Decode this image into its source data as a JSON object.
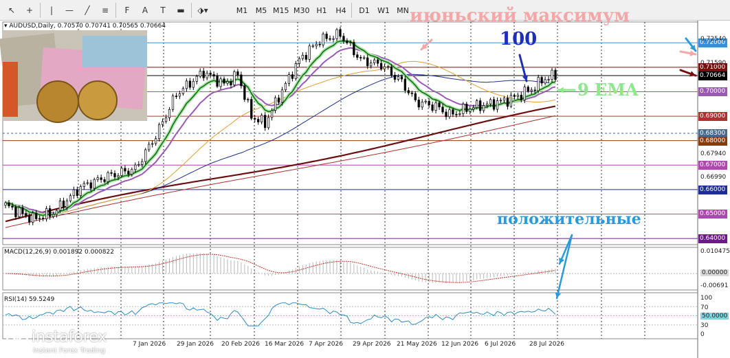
{
  "toolbar": {
    "tools": [
      {
        "name": "cursor-icon",
        "glyph": "↖"
      },
      {
        "name": "crosshair-icon",
        "glyph": "+"
      },
      {
        "name": "vertical-line-icon",
        "glyph": "|"
      },
      {
        "name": "horizontal-line-icon",
        "glyph": "—"
      },
      {
        "name": "trendline-icon",
        "glyph": "╱"
      },
      {
        "name": "channel-icon",
        "glyph": "≡"
      },
      {
        "name": "fibonacci-icon",
        "glyph": "F"
      },
      {
        "name": "text-icon",
        "glyph": "A"
      },
      {
        "name": "label-icon",
        "glyph": "T"
      },
      {
        "name": "rectangle-icon",
        "glyph": "▬"
      },
      {
        "name": "shapes-icon",
        "glyph": "⬗▾"
      }
    ],
    "timeframes": [
      "M1",
      "M5",
      "M15",
      "M30",
      "H1",
      "H4",
      "D1",
      "W1",
      "MN"
    ]
  },
  "header": {
    "symbol": "AUDUSD,Daily",
    "ohlc": "0.70570 0.70741 0.70565 0.70664"
  },
  "colors": {
    "candle_up": "#ffffff",
    "candle_down": "#000000",
    "ema9": "#1a6b1a",
    "ema9_glow": "#a6e6a6",
    "ma_purple": "#9b59b6",
    "ma_blue": "#1e2f8f",
    "ma_orange": "#e0a030",
    "ma_maroon": "#6b0f0f",
    "ma_red": "#b03030",
    "macd_hist": "#b8b8b8",
    "macd_signal": "#c0392b",
    "rsi": "#2e8bc0"
  },
  "price_axis": {
    "ticks": [
      {
        "value": "0.72540"
      },
      {
        "value": "0.71590"
      },
      {
        "value": "0.70000",
        "tag": true,
        "color": "#9b59b6"
      },
      {
        "value": "0.67940"
      },
      {
        "value": "0.66990"
      }
    ],
    "levels": [
      {
        "value": 0.72,
        "label": "0.72000",
        "color": "#3a8fd6"
      },
      {
        "value": 0.71,
        "label": "0.71000",
        "color": "#7a0e0e"
      },
      {
        "value": 0.7066,
        "label": "0.70664",
        "color": "#000000"
      },
      {
        "value": 0.7,
        "label": "0.70000",
        "color": "#9b59b6"
      },
      {
        "value": 0.69,
        "label": "0.69000",
        "color": "#b03030"
      },
      {
        "value": 0.683,
        "label": "0.68300",
        "color": "#4a6a8a"
      },
      {
        "value": 0.68,
        "label": "0.68000",
        "color": "#8b3a0e"
      },
      {
        "value": 0.67,
        "label": "0.67000",
        "color": "#b046b0"
      },
      {
        "value": 0.66,
        "label": "0.66000",
        "color": "#1e2f8f"
      },
      {
        "value": 0.65,
        "label": "0.65000",
        "color": "#b046b0"
      },
      {
        "value": 0.64,
        "label": "0.64000",
        "color": "#6b1a8a"
      }
    ]
  },
  "date_axis": [
    "7 Jan 2026",
    "29 Jan 2026",
    "20 Feb 2026",
    "16 Mar 2026",
    "7 Apr 2026",
    "29 Apr 2026",
    "21 May 2026",
    "12 Jun 2026",
    "6 Jul 2026",
    "28 Jul 2026"
  ],
  "macd": {
    "label": "MACD(12,26,9) 0.001892 0.000822",
    "ticks": [
      "0.010475",
      "0.00000",
      "-0.00691"
    ]
  },
  "rsi": {
    "label": "RSI(14) 59.5249",
    "ticks": [
      "100",
      "70",
      "50.0000",
      "30",
      "0"
    ]
  },
  "annotations": {
    "june_high": "июньский максимум",
    "ma100": "100",
    "ema9": "9 EMA",
    "positive": "положительные"
  },
  "logo": {
    "name": "instaforex",
    "tagline": "Instant Forex Trading"
  }
}
